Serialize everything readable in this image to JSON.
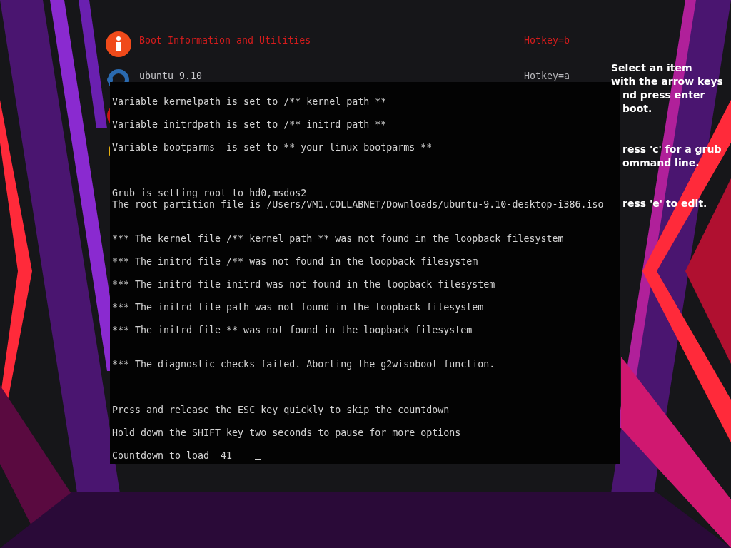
{
  "menu": {
    "items": [
      {
        "kind": "info",
        "label": "Boot Information and Utilities",
        "hotkey": "Hotkey=b",
        "selected": true
      },
      {
        "kind": "ubuntu",
        "label": "ubuntu 9.10",
        "hotkey": "Hotkey=a",
        "selected": false
      },
      {
        "kind": "red"
      },
      {
        "kind": "yellow"
      }
    ]
  },
  "help": [
    {
      "kind": "text",
      "text": "Select an item",
      "cut": false
    },
    {
      "kind": "text",
      "text": "with the arrow keys",
      "cut": false
    },
    {
      "kind": "text",
      "text": "nd press enter",
      "cut": true
    },
    {
      "kind": "text",
      "text": "boot.",
      "cut": true
    },
    {
      "kind": "blank"
    },
    {
      "kind": "blank"
    },
    {
      "kind": "text",
      "text": "ress 'c' for a grub",
      "cut": true
    },
    {
      "kind": "text",
      "text": "ommand line.",
      "cut": true
    },
    {
      "kind": "blank"
    },
    {
      "kind": "blank"
    },
    {
      "kind": "text",
      "text": "ress 'e' to edit.",
      "cut": true
    }
  ],
  "terminal": {
    "lines": [
      {
        "kind": "text",
        "text": "Variable kernelpath is set to /** kernel path **"
      },
      {
        "kind": "blank"
      },
      {
        "kind": "text",
        "text": "Variable initrdpath is set to /** initrd path **"
      },
      {
        "kind": "blank"
      },
      {
        "kind": "text",
        "text": "Variable bootparms  is set to ** your linux bootparms **"
      },
      {
        "kind": "blank"
      },
      {
        "kind": "blank"
      },
      {
        "kind": "blank"
      },
      {
        "kind": "text",
        "text": "Grub is setting root to hd0,msdos2"
      },
      {
        "kind": "text",
        "text": "The root partition file is /Users/VM1.COLLABNET/Downloads/ubuntu-9.10-desktop-i386.iso"
      },
      {
        "kind": "blank"
      },
      {
        "kind": "blank"
      },
      {
        "kind": "text",
        "text": "*** The kernel file /** kernel path ** was not found in the loopback filesystem"
      },
      {
        "kind": "blank"
      },
      {
        "kind": "text",
        "text": "*** The initrd file /** was not found in the loopback filesystem"
      },
      {
        "kind": "blank"
      },
      {
        "kind": "text",
        "text": "*** The initrd file initrd was not found in the loopback filesystem"
      },
      {
        "kind": "blank"
      },
      {
        "kind": "text",
        "text": "*** The initrd file path was not found in the loopback filesystem"
      },
      {
        "kind": "blank"
      },
      {
        "kind": "text",
        "text": "*** The initrd file ** was not found in the loopback filesystem"
      },
      {
        "kind": "blank"
      },
      {
        "kind": "blank"
      },
      {
        "kind": "text",
        "text": "*** The diagnostic checks failed. Aborting the g2wisoboot function."
      },
      {
        "kind": "blank"
      },
      {
        "kind": "blank"
      },
      {
        "kind": "blank"
      },
      {
        "kind": "text",
        "text": "Press and release the ESC key quickly to skip the countdown"
      },
      {
        "kind": "blank"
      },
      {
        "kind": "text",
        "text": "Hold down the SHIFT key two seconds to pause for more options"
      },
      {
        "kind": "blank"
      },
      {
        "kind": "prompt",
        "text": "Countdown to load  41"
      }
    ]
  }
}
